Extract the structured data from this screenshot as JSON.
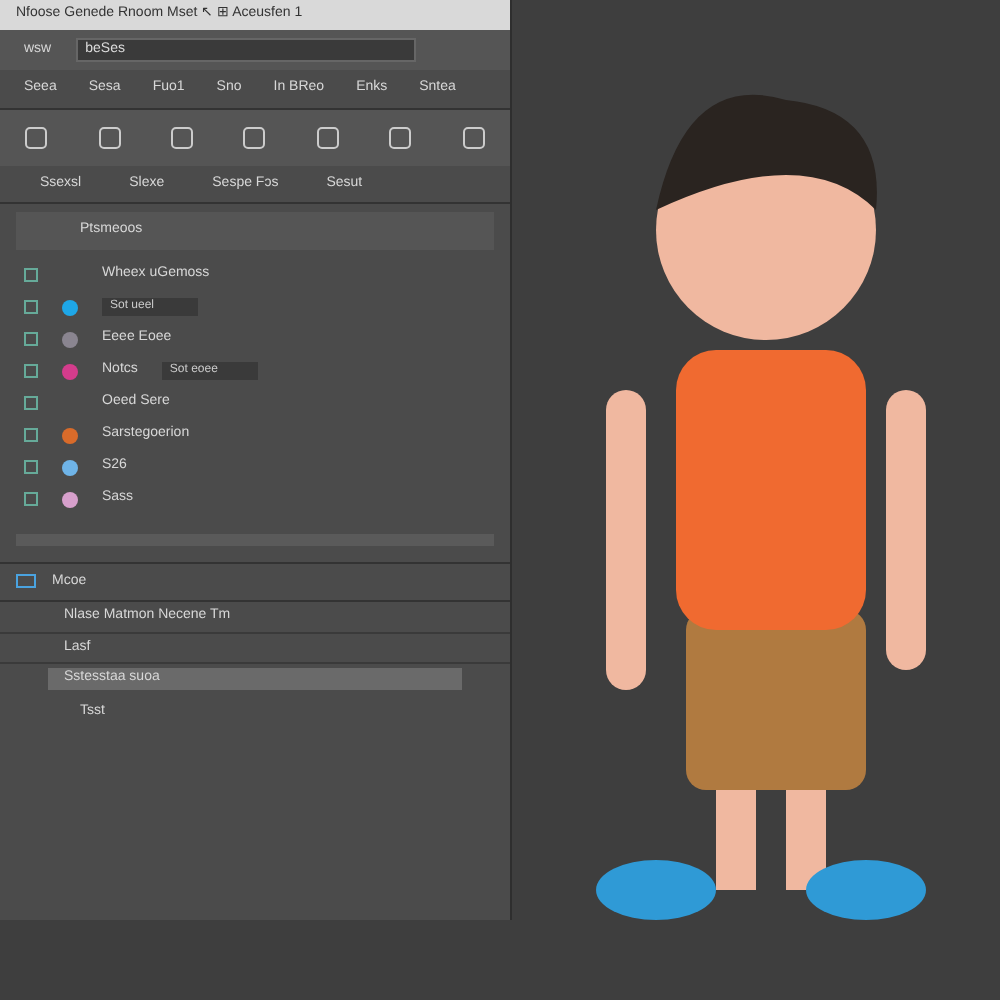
{
  "window": {
    "title": "Nfoose Genede Rnoom Mset ↖ ⊞ Aceusfen 1"
  },
  "search": {
    "tab": "wsw",
    "value": "beSes"
  },
  "toolbar": [
    "Seea",
    "Sesa",
    "Fuo1",
    "Sno",
    "In BReo",
    "Enks",
    "Sntea"
  ],
  "tabs": [
    {
      "label": "Ssexsl",
      "selected": false
    },
    {
      "label": "Slexe",
      "selected": false
    },
    {
      "label": "Sespe Fɔs",
      "selected": false
    },
    {
      "label": "Sesut",
      "selected": false
    }
  ],
  "section": {
    "title": "Ptsmeoos"
  },
  "items": [
    {
      "label": "Wheex uGemoss"
    },
    {
      "color": "#1ea7e8",
      "field": "Sot ueel"
    },
    {
      "color": "#8a8590",
      "label": "Eeee Eoee"
    },
    {
      "color": "#d43c8c",
      "label": "Notcs",
      "field": "Sot eoee"
    },
    {
      "label": "Oeed Sere"
    },
    {
      "color": "#d96b2a",
      "label": "Sarstegoerion"
    },
    {
      "color": "#6fb4e8",
      "label": "S26"
    },
    {
      "color": "#d7a0cc",
      "label": "Sass"
    }
  ],
  "bottom": {
    "title": "Mcoe",
    "rows": [
      "Nlase Matmon Necene Tm",
      "Lasf"
    ],
    "selected_row": "Sstesstaa suoa",
    "item": "Tsst"
  }
}
